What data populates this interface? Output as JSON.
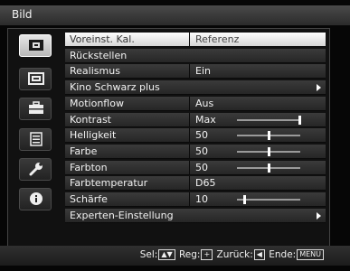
{
  "window": {
    "title": "Bild"
  },
  "sidebar": {
    "items": [
      {
        "icon": "picture-icon",
        "active": true
      },
      {
        "icon": "screen-icon",
        "active": false
      },
      {
        "icon": "toolbox-icon",
        "active": false
      },
      {
        "icon": "list-icon",
        "active": false
      },
      {
        "icon": "wrench-icon",
        "active": false
      },
      {
        "icon": "info-icon",
        "active": false
      }
    ]
  },
  "menu": {
    "rows": [
      {
        "label": "Voreinst. Kal.",
        "value": "Referenz",
        "selected": true,
        "arrow": false,
        "slider": null
      },
      {
        "label": "Rückstellen",
        "value": "",
        "selected": false,
        "arrow": false,
        "slider": null
      },
      {
        "label": "Realismus",
        "value": "Ein",
        "selected": false,
        "arrow": false,
        "slider": null
      },
      {
        "label": "Kino Schwarz plus",
        "value": "",
        "selected": false,
        "arrow": true,
        "slider": null
      },
      {
        "label": "Motionflow",
        "value": "Aus",
        "selected": false,
        "arrow": false,
        "slider": null
      },
      {
        "label": "Kontrast",
        "value": "Max",
        "selected": false,
        "arrow": false,
        "slider": {
          "level": 1.0,
          "centered": false
        }
      },
      {
        "label": "Helligkeit",
        "value": "50",
        "selected": false,
        "arrow": false,
        "slider": {
          "level": 0.5,
          "centered": false
        }
      },
      {
        "label": "Farbe",
        "value": "50",
        "selected": false,
        "arrow": false,
        "slider": {
          "level": 0.5,
          "centered": true
        }
      },
      {
        "label": "Farbton",
        "value": "50",
        "selected": false,
        "arrow": false,
        "slider": {
          "level": 0.5,
          "centered": true
        }
      },
      {
        "label": "Farbtemperatur",
        "value": "D65",
        "selected": false,
        "arrow": false,
        "slider": null
      },
      {
        "label": "Schärfe",
        "value": "10",
        "selected": false,
        "arrow": false,
        "slider": {
          "level": 0.1,
          "centered": false
        }
      },
      {
        "label": "Experten-Einstellung",
        "value": "",
        "selected": false,
        "arrow": true,
        "slider": null
      }
    ]
  },
  "footer": {
    "sel_label": "Sel:",
    "reg_label": "Reg:",
    "back_label": "Zurück:",
    "end_label": "Ende:",
    "menu_key": "MENU"
  }
}
